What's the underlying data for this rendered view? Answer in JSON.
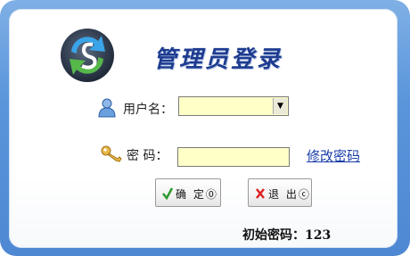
{
  "title": "管理员登录",
  "username_label": "用户名：",
  "username_value": "",
  "password_label": "密  码：",
  "password_value": "",
  "change_password_link": "修改密码",
  "ok_button": "确 定⓪",
  "exit_button": "退 出ⓒ",
  "hint": "初始密码：123",
  "icons": {
    "logo": "refresh-logo-icon",
    "user": "user-icon",
    "password": "key-icon",
    "ok": "checkmark-icon",
    "exit": "x-icon"
  }
}
